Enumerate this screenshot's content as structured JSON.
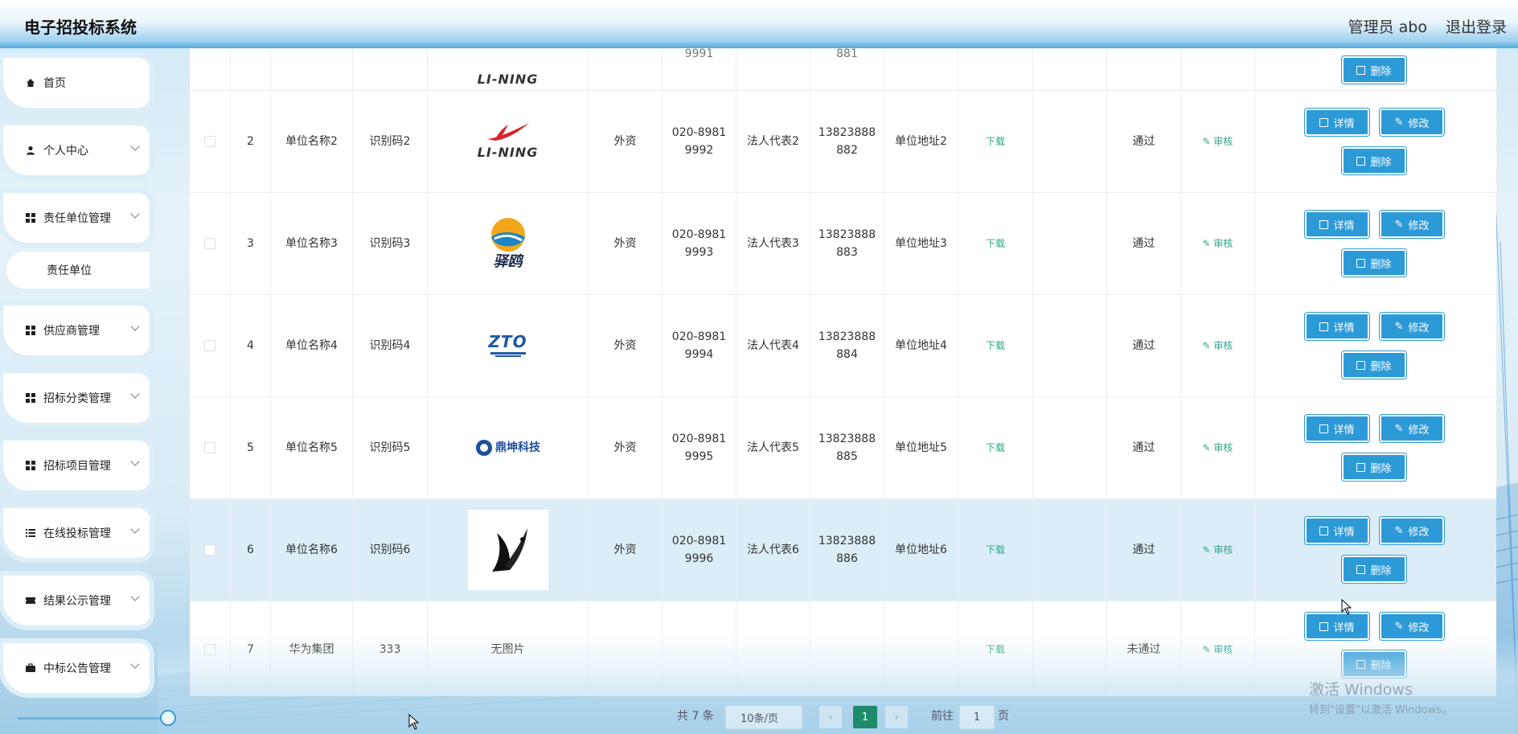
{
  "header": {
    "app_title": "电子招投标系统",
    "admin_label": "管理员 abo",
    "logout": "退出登录"
  },
  "sidebar": {
    "items": [
      {
        "label": "首页",
        "icon": "home-icon"
      },
      {
        "label": "个人中心",
        "icon": "user-icon"
      },
      {
        "label": "责任单位管理",
        "icon": "grid-icon"
      },
      {
        "label": "供应商管理",
        "icon": "grid-icon"
      },
      {
        "label": "招标分类管理",
        "icon": "grid-icon"
      },
      {
        "label": "招标项目管理",
        "icon": "grid-icon"
      },
      {
        "label": "在线投标管理",
        "icon": "list-icon"
      },
      {
        "label": "结果公示管理",
        "icon": "ticket-icon"
      },
      {
        "label": "中标公告管理",
        "icon": "briefcase-icon"
      }
    ],
    "sub_item": "责任单位"
  },
  "table": {
    "partial_top_row": {
      "logo_text": "LI-NING",
      "phone_tail": "9991",
      "mobile_tail": "881",
      "delete": "删除"
    },
    "rows": [
      {
        "idx": "2",
        "name": "单位名称2",
        "code": "识别码2",
        "logo": "LI-NING",
        "type": "外资",
        "phone1": "020-8981",
        "phone2": "9992",
        "legal": "法人代表2",
        "mobile1": "13823888",
        "mobile2": "882",
        "address": "单位地址2",
        "download": "下载",
        "status": "通过",
        "audit": "审核"
      },
      {
        "idx": "3",
        "name": "单位名称3",
        "code": "识别码3",
        "logo": "驿鸥",
        "type": "外资",
        "phone1": "020-8981",
        "phone2": "9993",
        "legal": "法人代表3",
        "mobile1": "13823888",
        "mobile2": "883",
        "address": "单位地址3",
        "download": "下载",
        "status": "通过",
        "audit": "审核"
      },
      {
        "idx": "4",
        "name": "单位名称4",
        "code": "识别码4",
        "logo": "ZTO",
        "type": "外资",
        "phone1": "020-8981",
        "phone2": "9994",
        "legal": "法人代表4",
        "mobile1": "13823888",
        "mobile2": "884",
        "address": "单位地址4",
        "download": "下载",
        "status": "通过",
        "audit": "审核"
      },
      {
        "idx": "5",
        "name": "单位名称5",
        "code": "识别码5",
        "logo": "鼎坤科技",
        "type": "外资",
        "phone1": "020-8981",
        "phone2": "9995",
        "legal": "法人代表5",
        "mobile1": "13823888",
        "mobile2": "885",
        "address": "单位地址5",
        "download": "下载",
        "status": "通过",
        "audit": "审核"
      },
      {
        "idx": "6",
        "name": "单位名称6",
        "code": "识别码6",
        "logo": "",
        "type": "外资",
        "phone1": "020-8981",
        "phone2": "9996",
        "legal": "法人代表6",
        "mobile1": "13823888",
        "mobile2": "886",
        "address": "单位地址6",
        "download": "下载",
        "status": "通过",
        "audit": "审核"
      },
      {
        "idx": "7",
        "name": "华为集团",
        "code": "333",
        "logo": "无图片",
        "type": "",
        "phone1": "",
        "phone2": "",
        "legal": "",
        "mobile1": "",
        "mobile2": "",
        "address": "",
        "download": "下载",
        "status": "未通过",
        "audit": "审核"
      }
    ],
    "actions": {
      "detail": "详情",
      "edit": "修改",
      "delete": "删除"
    }
  },
  "pagination": {
    "total": "共 7 条",
    "page_size": "10条/页",
    "current": "1",
    "goto_prefix": "前往",
    "goto_value": "1",
    "goto_suffix": "页"
  },
  "watermark": {
    "line1": "激活 Windows",
    "line2": "转到\"设置\"以激活 Windows。"
  },
  "colors": {
    "accent": "#2d9ad8",
    "link": "#2fa58b",
    "current_page": "#1e8a6b",
    "row_highlight": "#dcedf7"
  }
}
